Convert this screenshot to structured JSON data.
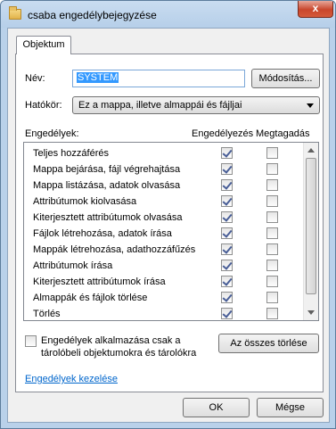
{
  "window": {
    "title": "csaba engedélybejegyzése",
    "close_glyph": "x"
  },
  "tabs": [
    {
      "label": "Objektum"
    }
  ],
  "name": {
    "label": "Név:",
    "value": "SYSTEM",
    "change_button": "Módosítás..."
  },
  "scope": {
    "label": "Hatókör:",
    "value": "Ez a mappa, illetve almappái és fájljai"
  },
  "permissions": {
    "header_label": "Engedélyek:",
    "allow_header": "Engedélyezés",
    "deny_header": "Megtagadás",
    "items": [
      {
        "label": "Teljes hozzáférés",
        "allow": true,
        "deny": false
      },
      {
        "label": "Mappa bejárása, fájl végrehajtása",
        "allow": true,
        "deny": false
      },
      {
        "label": "Mappa listázása, adatok olvasása",
        "allow": true,
        "deny": false
      },
      {
        "label": "Attribútumok kiolvasása",
        "allow": true,
        "deny": false
      },
      {
        "label": "Kiterjesztett attribútumok olvasása",
        "allow": true,
        "deny": false
      },
      {
        "label": "Fájlok létrehozása, adatok írása",
        "allow": true,
        "deny": false
      },
      {
        "label": "Mappák létrehozása, adathozzáfűzés",
        "allow": true,
        "deny": false
      },
      {
        "label": "Attribútumok írása",
        "allow": true,
        "deny": false
      },
      {
        "label": "Kiterjesztett attribútumok írása",
        "allow": true,
        "deny": false
      },
      {
        "label": "Almappák és fájlok törlése",
        "allow": true,
        "deny": false
      },
      {
        "label": "Törlés",
        "allow": true,
        "deny": false
      },
      {
        "label": "",
        "allow": false,
        "deny": false
      }
    ]
  },
  "apply_option": {
    "line1": "Engedélyek alkalmazása csak a",
    "line2": "tárolóbeli objektumokra és tárolókra",
    "checked": false
  },
  "clear_all_button": "Az összes törlése",
  "manage_link": "Engedélyek kezelése",
  "ok_button": "OK",
  "cancel_button": "Mégse"
}
